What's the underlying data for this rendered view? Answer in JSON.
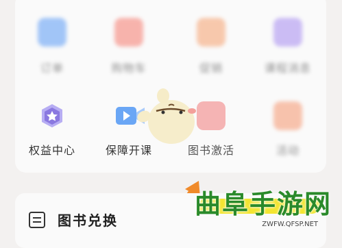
{
  "row1": {
    "items": [
      {
        "label": "订单",
        "color": "#5a9af5"
      },
      {
        "label": "购物车",
        "color": "#f57a6e"
      },
      {
        "label": "促销",
        "color": "#f5a06e"
      },
      {
        "label": "课程消息",
        "color": "#a58af0"
      }
    ]
  },
  "row2": {
    "items": [
      {
        "label": "权益中心",
        "color": "#8a78e0"
      },
      {
        "label": "保障开课",
        "color": "#4a8cf0"
      },
      {
        "label": "图书激活",
        "color": "#f06a6a"
      },
      {
        "label": "活动",
        "color": "#f5956e"
      }
    ]
  },
  "exchange": {
    "label": "图书兑换"
  },
  "watermark": {
    "title": "曲阜手游网",
    "url": "ZWFW.QFSP.NET"
  },
  "colors": {
    "accent_arrow": "#f08a2a",
    "watermark_green": "#2a8a2a",
    "watermark_yellow": "#f2e21a"
  }
}
